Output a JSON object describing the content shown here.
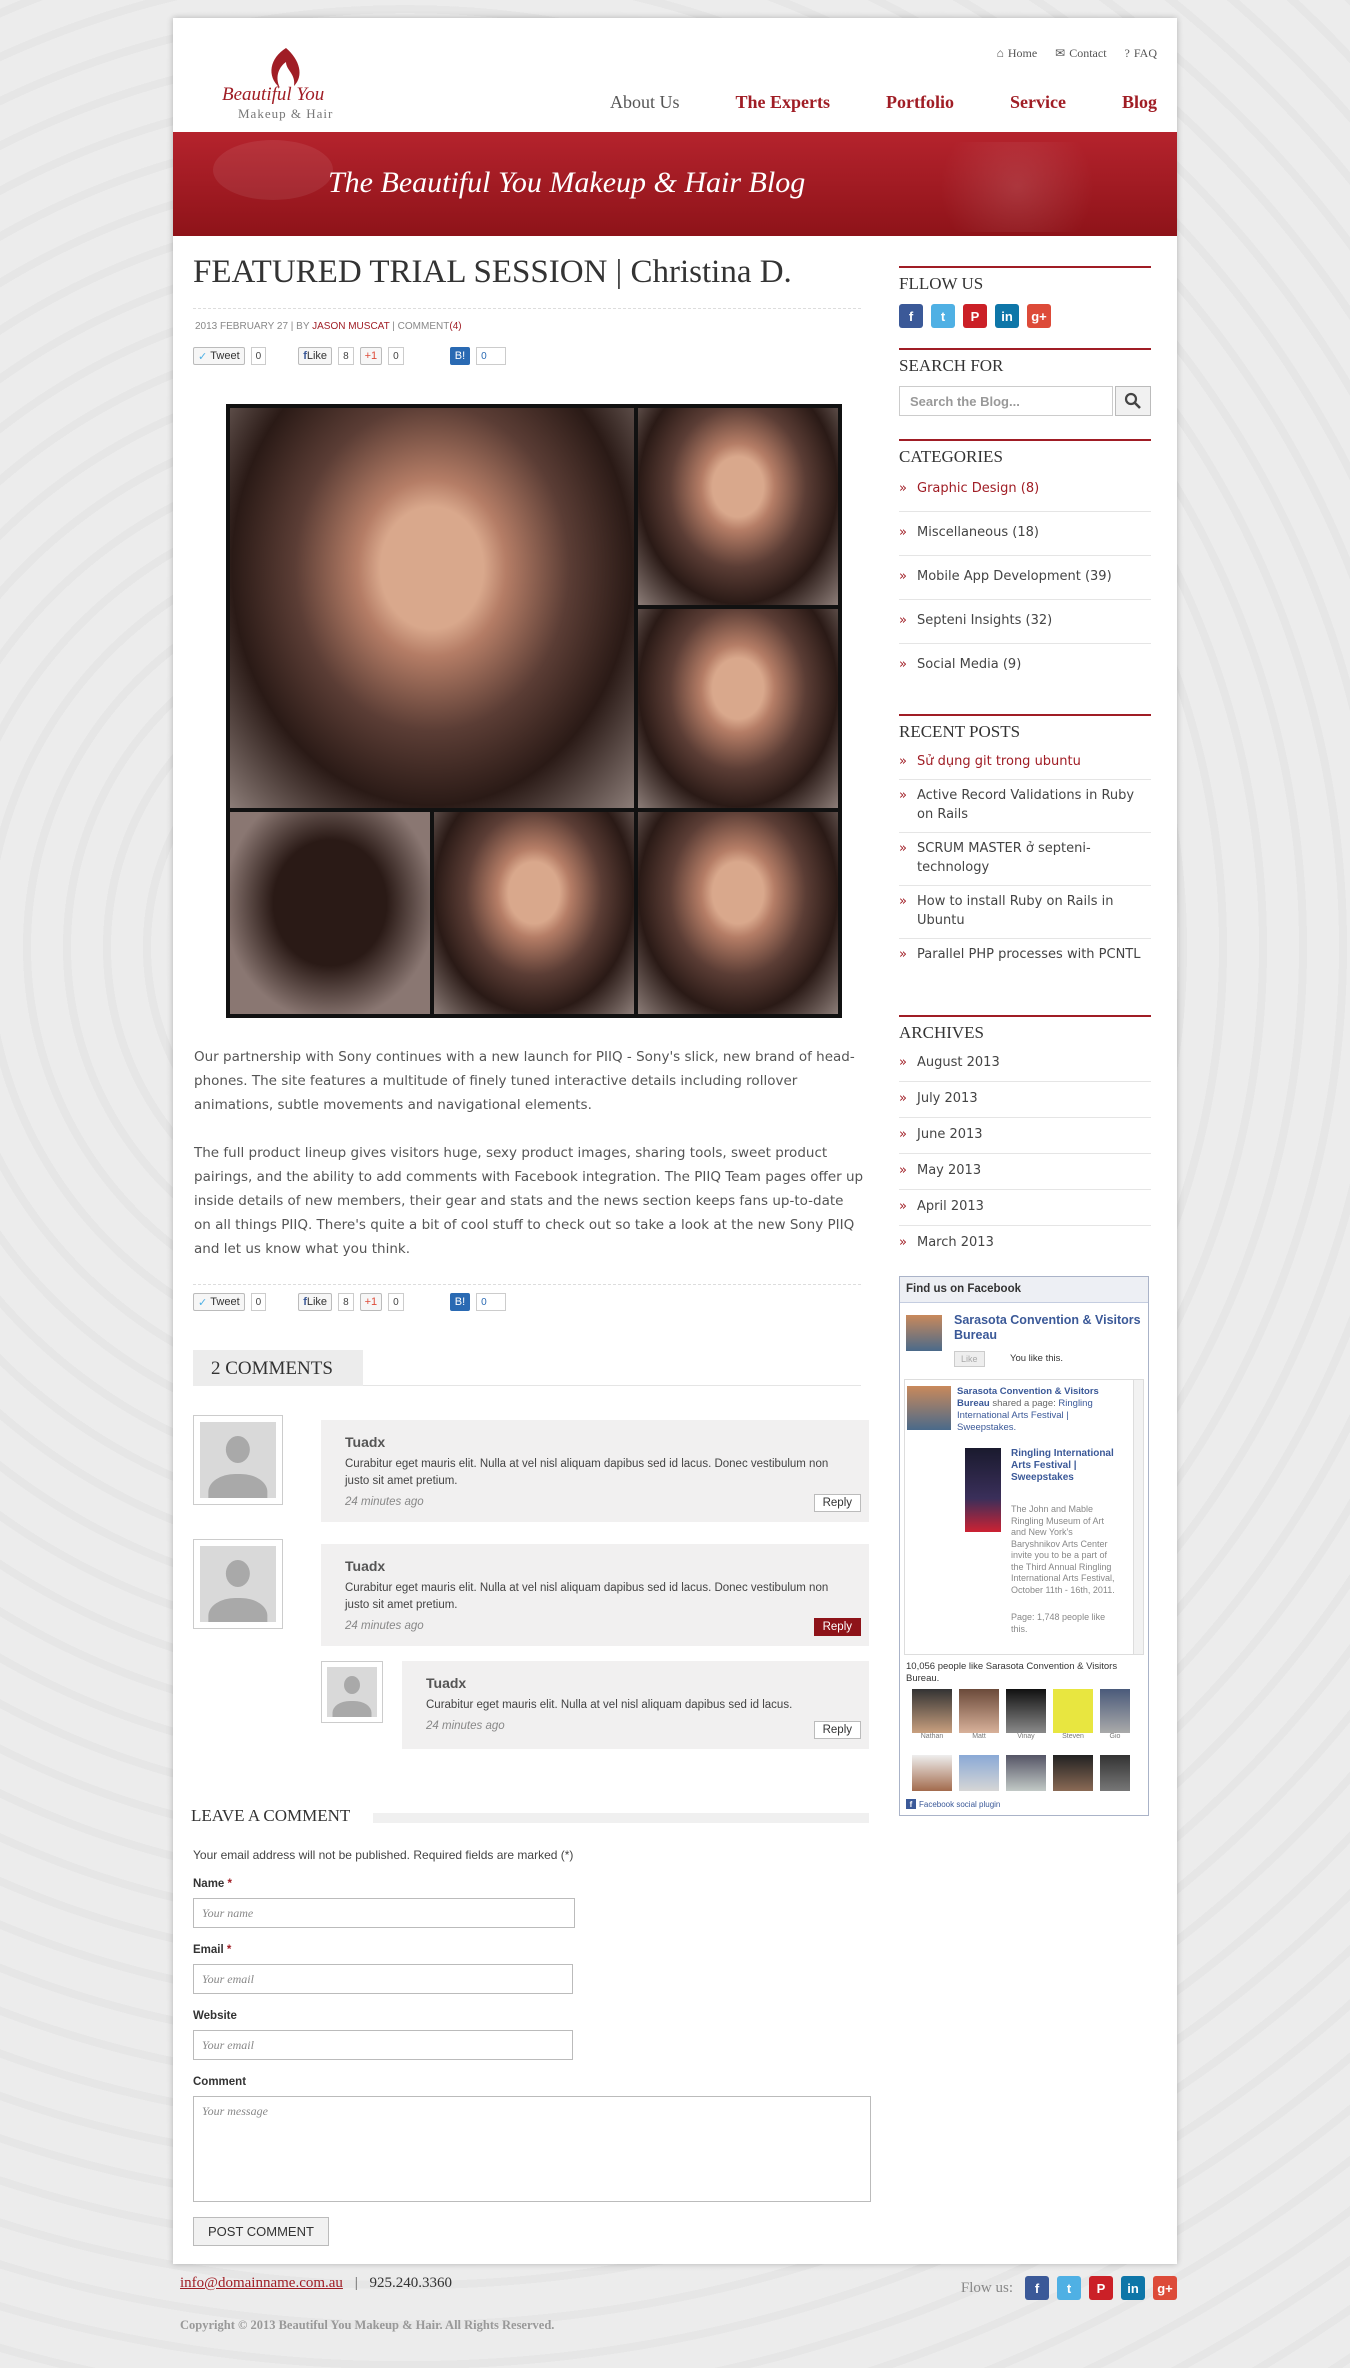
{
  "header": {
    "logo_line1": "Beautiful You",
    "logo_line2": "Makeup & Hair",
    "top_links": [
      "Home",
      "Contact",
      "FAQ"
    ],
    "nav": [
      "About Us",
      "The Experts",
      "Portfolio",
      "Service",
      "Blog"
    ],
    "banner_title": "The  Beautiful You Makeup & Hair Blog"
  },
  "post": {
    "title": "FEATURED TRIAL SESSION | Christina D.",
    "meta_date": "2013 FEBRUARY 27 | BY ",
    "meta_author": "JASON MUSCAT",
    "meta_comment": " | COMMENT",
    "meta_count": "(4)",
    "share": {
      "tweet": "Tweet",
      "tweet_count": "0",
      "like": "Like",
      "like_count": "8",
      "plus": "+1",
      "plus_count": "0",
      "b_count": "0"
    },
    "para1": "Our partnership with Sony continues with a new launch for PIIQ - Sony's slick, new brand of head-phones. The site features a multitude of finely tuned interactive details including rollover animations, subtle movements and navigational elements.",
    "para2": "The full product lineup gives visitors huge, sexy product images, sharing tools, sweet product pairings, and the ability to add comments with Facebook integration. The PIIQ Team pages offer up inside details of new members, their gear and stats and the news section keeps fans up-to-date on all things PIIQ. There's quite a bit of cool stuff to check out so take a look at the new Sony PIIQ and let us know what you think."
  },
  "comments": {
    "title": "2 COMMENTS",
    "items": [
      {
        "name": "Tuadx",
        "text": "Curabitur eget mauris elit. Nulla at vel nisl aliquam dapibus sed id lacus. Donec vestibulum non justo sit amet pretium.",
        "time": "24 minutes ago",
        "reply": "Reply"
      },
      {
        "name": "Tuadx",
        "text": "Curabitur eget mauris elit. Nulla at vel nisl aliquam dapibus sed id lacus. Donec vestibulum non justo sit amet pretium.",
        "time": "24 minutes ago",
        "reply": "Reply"
      },
      {
        "name": "Tuadx",
        "text": "Curabitur eget mauris elit. Nulla at vel nisl aliquam dapibus sed id lacus.",
        "time": "24 minutes ago",
        "reply": "Reply"
      }
    ]
  },
  "form": {
    "title": "LEAVE A COMMENT",
    "note": "Your email address will not be published. Required fields are marked (*)",
    "name_label": "Name",
    "email_label": "Email",
    "website_label": "Website",
    "comment_label": "Comment",
    "required": "*",
    "name_ph": "Your name",
    "email_ph": "Your email",
    "website_ph": "Your email",
    "comment_ph": "Your message",
    "submit": "POST COMMENT"
  },
  "sidebar": {
    "follow_title": "FLLOW US",
    "search_title": "SEARCH FOR",
    "search_ph": "Search the Blog...",
    "categories_title": "CATEGORIES",
    "categories": [
      "Graphic Design (8)",
      "Miscellaneous (18)",
      "Mobile App Development (39)",
      "Septeni Insights (32)",
      "Social Media (9)"
    ],
    "recent_title": "RECENT POSTS",
    "recent": [
      "Sử dụng git trong ubuntu",
      "Active Record Validations in Ruby on Rails",
      "SCRUM MASTER ở septeni-technology",
      "How to install Ruby on Rails in Ubuntu",
      "Parallel PHP processes with PCNTL"
    ],
    "archives_title": "ARCHIVES",
    "archives": [
      "August 2013",
      "July 2013",
      "June 2013",
      "May 2013",
      "April 2013",
      "March 2013"
    ]
  },
  "facebook": {
    "title": "Find us on Facebook",
    "page": "Sarasota Convention & Visitors Bureau",
    "like": "Like",
    "you_like": "You like this.",
    "post_author": "Sarasota Convention & Visitors Bureau",
    "post_action": "shared a page:",
    "post_link": "Ringling International Arts Festival | Sweepstakes.",
    "shared_title": "Ringling International Arts Festival | Sweepstakes",
    "shared_desc": "The John and Mable Ringling Museum of Art and New York's Baryshnikov Arts Center invite you to be a part of the Third Annual Ringling International Arts Festival, October 11th - 16th, 2011.",
    "page_likes": "Page: 1,748 people like this.",
    "people_like": "10,056 people like Sarasota Convention & Visitors Bureau.",
    "faces": [
      "Nathan",
      "Matt",
      "Vinay",
      "Steven",
      "Gio"
    ],
    "plugin": "Facebook social plugin"
  },
  "footer": {
    "email": "info@domainname.com.au",
    "sep": "|",
    "phone": "925.240.3360",
    "follow": "Flow us:",
    "copyright": "Copyright © 2013 Beautiful You Makeup & Hair. All Rights Reserved."
  },
  "colors": {
    "accent": "#a01d25",
    "banner": "#8e1319",
    "fb": "#3b5998"
  }
}
